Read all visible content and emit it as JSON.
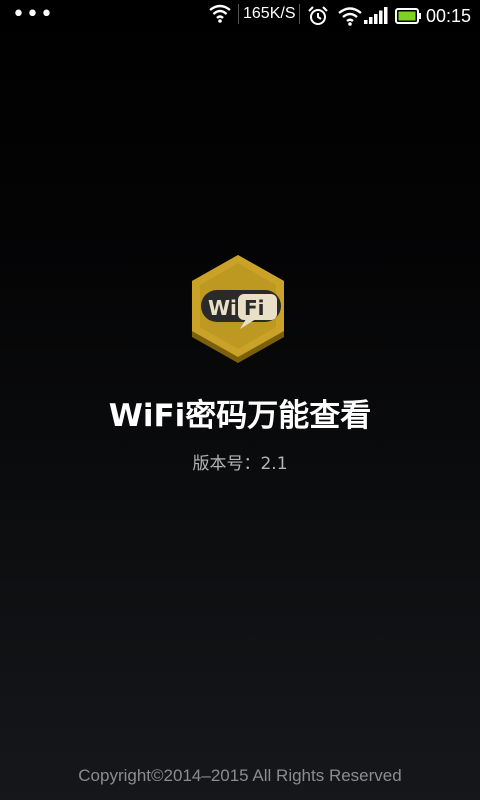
{
  "status_bar": {
    "left_indicator": "•••",
    "network_speed": "165K/S",
    "time": "00:15",
    "icons": [
      "wifi-icon",
      "alarm-icon",
      "wifi-icon",
      "signal-icon",
      "battery-icon"
    ],
    "battery_color": "#7ed321"
  },
  "logo": {
    "text_wi": "Wi",
    "text_fi": "Fi",
    "colors": {
      "hex_outer": "#8a6d10",
      "hex_inner": "#c9a227",
      "hex_top": "#d8b43a",
      "bubble": "#2a2a2a"
    }
  },
  "app": {
    "title": "WiFi密码万能查看",
    "version_label": "版本号：",
    "version": "2.1"
  },
  "footer": {
    "copyright": "Copyright©2014–2015 All Rights Reserved"
  }
}
